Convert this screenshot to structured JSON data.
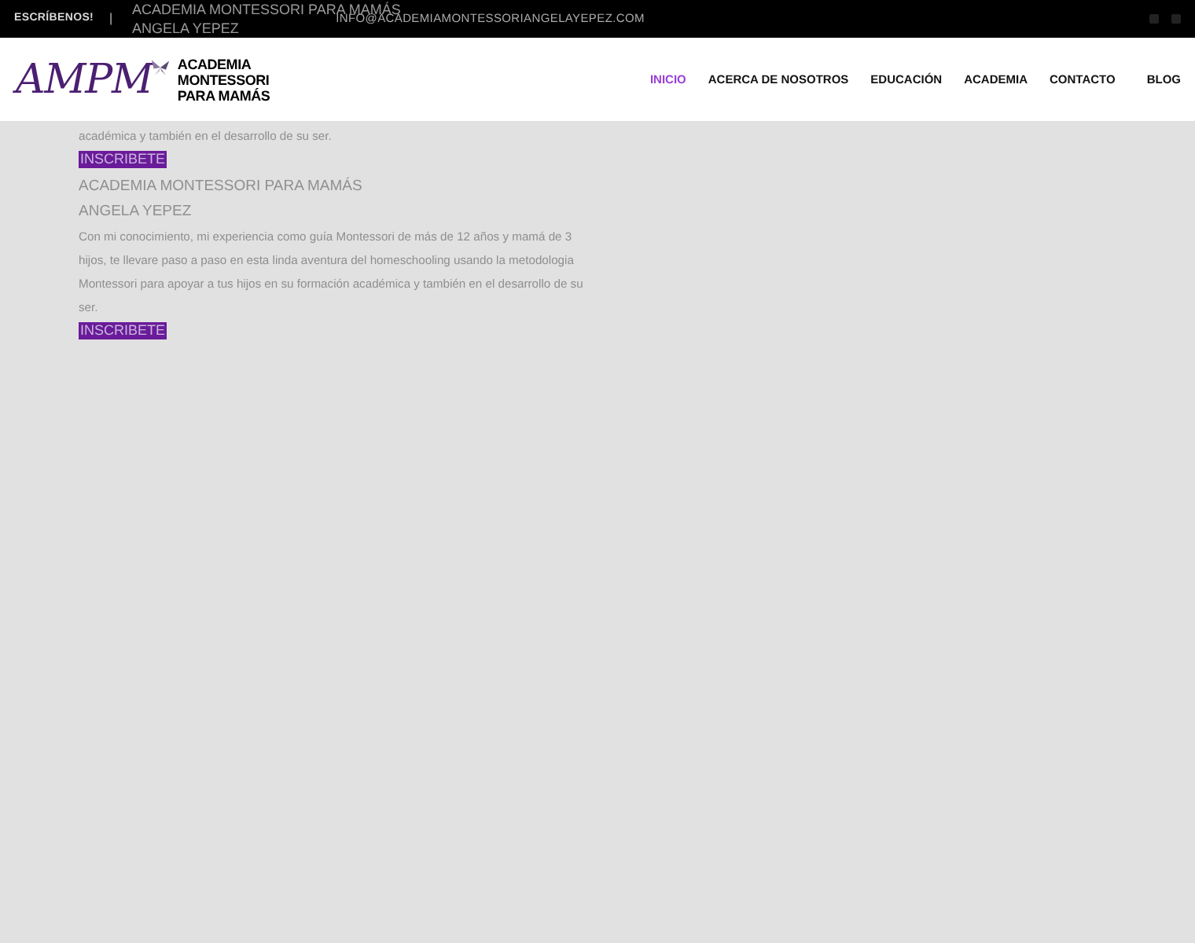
{
  "top_bar": {
    "label": "ESCRÍBENOS!",
    "separator": "|",
    "email": "INFO@ACADEMIAMONTESSORIANGELAYEPEZ.COM"
  },
  "hidden_block": {
    "title": "ACADEMIA MONTESSORI PARA MAMÁS",
    "name": "ANGELA YEPEZ"
  },
  "logo": {
    "monogram": "AMPM",
    "lines": [
      "ACADEMIA",
      "MONTESSORI",
      "PARA MAMÁS"
    ]
  },
  "nav": [
    {
      "label": "INICIO",
      "selected": true
    },
    {
      "label": "ACERCA DE NOSOTROS",
      "selected": false
    },
    {
      "label": "EDUCACIÓN",
      "selected": false
    },
    {
      "label": "ACADEMIA",
      "selected": false
    },
    {
      "label": "CONTACTO",
      "selected": false
    },
    {
      "label": "BLOG",
      "selected": false
    }
  ],
  "blocks": [
    {
      "paragraph": "académica y también en el desarrollo de su ser.",
      "button": "INSCRIBETE"
    },
    {
      "title": "ACADEMIA MONTESSORI PARA MAMÁS",
      "name": "ANGELA YEPEZ",
      "paragraph": "Con mi conocimiento, mi experiencia como guía Montessori de más de 12 años y mamá de 3 hijos, te llevare paso a paso en esta linda aventura del homeschooling usando la metodologia Montessori para apoyar a tus hijos en su formación académica y también en el desarrollo de su ser.",
      "button": "INSCRIBETE"
    }
  ]
}
